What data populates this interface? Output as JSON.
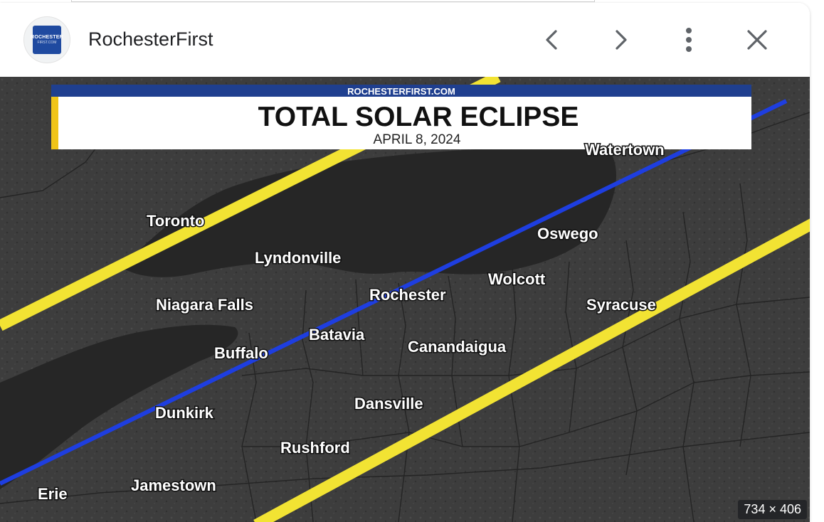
{
  "header": {
    "site_name": "RochesterFirst",
    "favicon_text_top": "ROCHESTER",
    "favicon_text_bottom": "FIRST.COM"
  },
  "icons": {
    "previous": "chevron-left-icon",
    "next": "chevron-right-icon",
    "more": "more-vertical-icon",
    "close": "close-icon"
  },
  "image": {
    "banner_site": "ROCHESTERFIRST.COM",
    "banner_title": "TOTAL SOLAR ECLIPSE",
    "banner_date": "APRIL 8, 2024",
    "cities": {
      "watertown": "Watertown",
      "toronto": "Toronto",
      "oswego": "Oswego",
      "lyndonville": "Lyndonville",
      "wolcott": "Wolcott",
      "rochester": "Rochester",
      "niagara_falls": "Niagara Falls",
      "syracuse": "Syracuse",
      "batavia": "Batavia",
      "canandaigua": "Canandaigua",
      "buffalo": "Buffalo",
      "dansville": "Dansville",
      "dunkirk": "Dunkirk",
      "rushford": "Rushford",
      "jamestown": "Jamestown",
      "erie": "Erie"
    },
    "dimensions": "734 × 406"
  },
  "colors": {
    "path_edge": "#f2e333",
    "centerline": "#1e3ee0",
    "banner_blue": "#1f3f8f",
    "banner_accent": "#f0c419",
    "lake": "#242424",
    "land": "#4a4a4a"
  }
}
